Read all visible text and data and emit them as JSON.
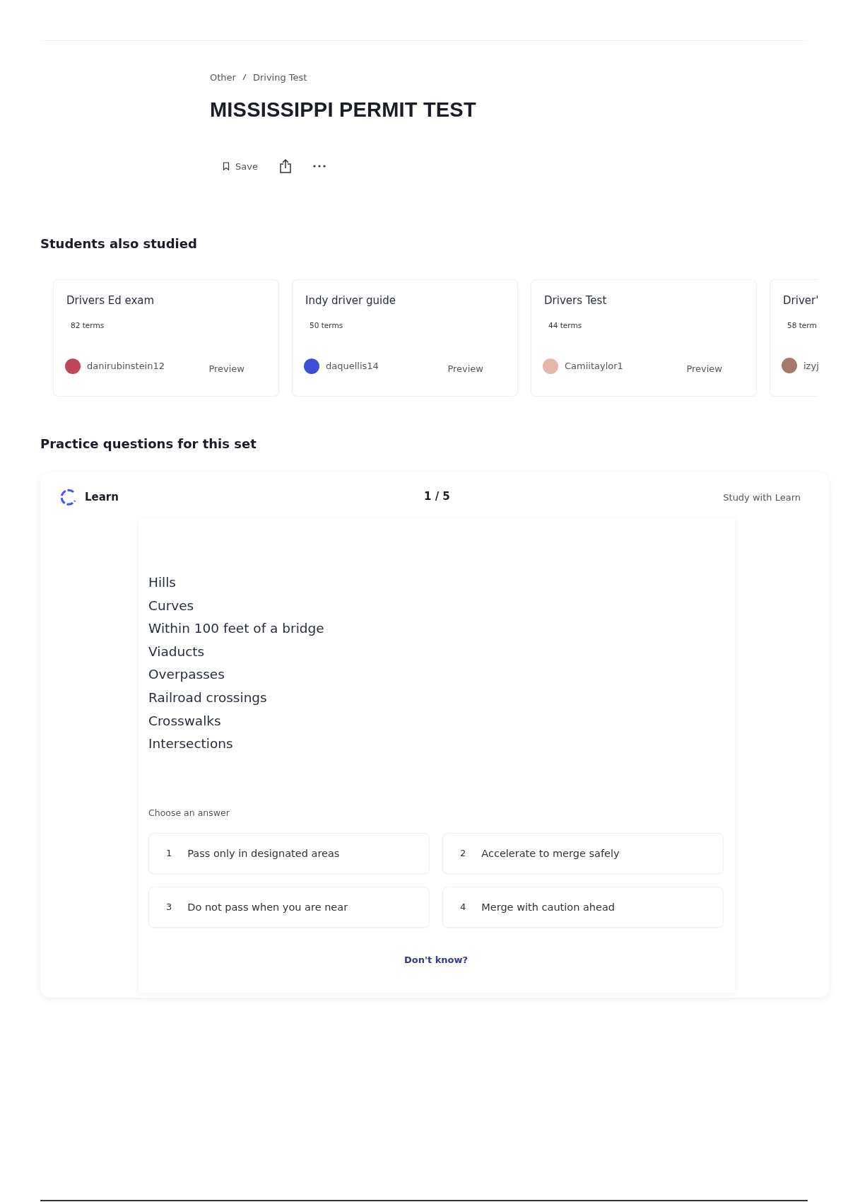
{
  "breadcrumb": [
    "Other",
    "Driving Test"
  ],
  "title": "MISSISSIPPI PERMIT TEST",
  "actions": {
    "save": "Save"
  },
  "related": {
    "heading": "Students also studied",
    "cards": [
      {
        "title": "Drivers Ed exam",
        "terms": "82 terms",
        "author": "danirubinstein12",
        "color": "#c0475a",
        "preview": "Preview",
        "clipped": false
      },
      {
        "title": "Indy driver guide",
        "terms": "50 terms",
        "author": "daquellis14",
        "color": "#3d4fd6",
        "preview": "Preview",
        "clipped": false
      },
      {
        "title": "Drivers Test",
        "terms": "44 terms",
        "author": "Camiitaylor1",
        "color": "#e3b8a8",
        "preview": "Preview",
        "clipped": false
      },
      {
        "title": "Driver'",
        "terms": "58 term",
        "author": "izyj",
        "color": "#a57a6a",
        "clipped": true
      }
    ]
  },
  "practice": {
    "heading": "Practice questions for this set",
    "mode": "Learn",
    "progress": "1 / 5",
    "study_link": "Study with Learn",
    "prompt": [
      "Hills",
      "Curves",
      "Within 100 feet of a bridge",
      "Viaducts",
      "Overpasses",
      "Railroad crossings",
      "Crosswalks",
      "Intersections"
    ],
    "choose_label": "Choose an answer",
    "answers": [
      {
        "number": "1",
        "text": "Pass only in designated areas"
      },
      {
        "number": "2",
        "text": "Accelerate to merge safely"
      },
      {
        "number": "3",
        "text": "Do not pass when you are near"
      },
      {
        "number": "4",
        "text": "Merge with caution ahead"
      }
    ],
    "dont_know": "Don't know?"
  }
}
